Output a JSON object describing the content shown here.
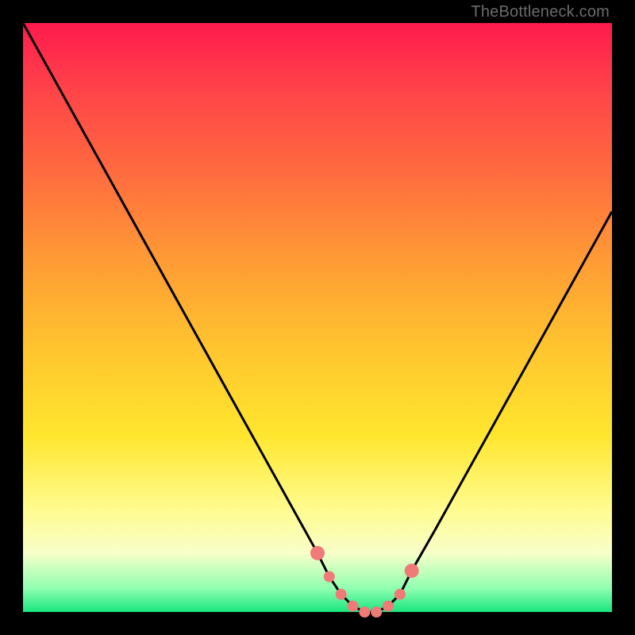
{
  "watermark": "TheBottleneck.com",
  "colors": {
    "frame": "#000000",
    "curve": "#000000",
    "dot": "#ef7a78",
    "gradient_stops": [
      "#ff1a4d",
      "#ff3f4a",
      "#ff6a3f",
      "#ff9a35",
      "#ffc42f",
      "#ffe62e",
      "#fffb8a",
      "#f8ffc9",
      "#8fffb0",
      "#19e67f"
    ]
  },
  "chart_data": {
    "type": "line",
    "title": "",
    "xlabel": "",
    "ylabel": "",
    "xlim": [
      0,
      100
    ],
    "ylim": [
      0,
      100
    ],
    "x": [
      0,
      5,
      10,
      15,
      20,
      25,
      30,
      35,
      40,
      45,
      50,
      52,
      54,
      56,
      58,
      60,
      62,
      64,
      66,
      70,
      75,
      80,
      85,
      90,
      95,
      100
    ],
    "series": [
      {
        "name": "bottleneck-curve",
        "values": [
          100,
          91,
          82,
          73,
          64,
          55,
          46,
          37,
          28,
          19,
          10,
          6,
          3,
          1,
          0,
          0,
          1,
          3,
          7,
          14,
          23,
          32,
          41,
          50,
          59,
          68
        ]
      }
    ],
    "highlight_points": {
      "name": "optimal-range-dots",
      "x": [
        50,
        52,
        54,
        56,
        58,
        60,
        62,
        64,
        66
      ],
      "y": [
        10,
        6,
        3,
        1,
        0,
        0,
        1,
        3,
        7
      ]
    }
  }
}
